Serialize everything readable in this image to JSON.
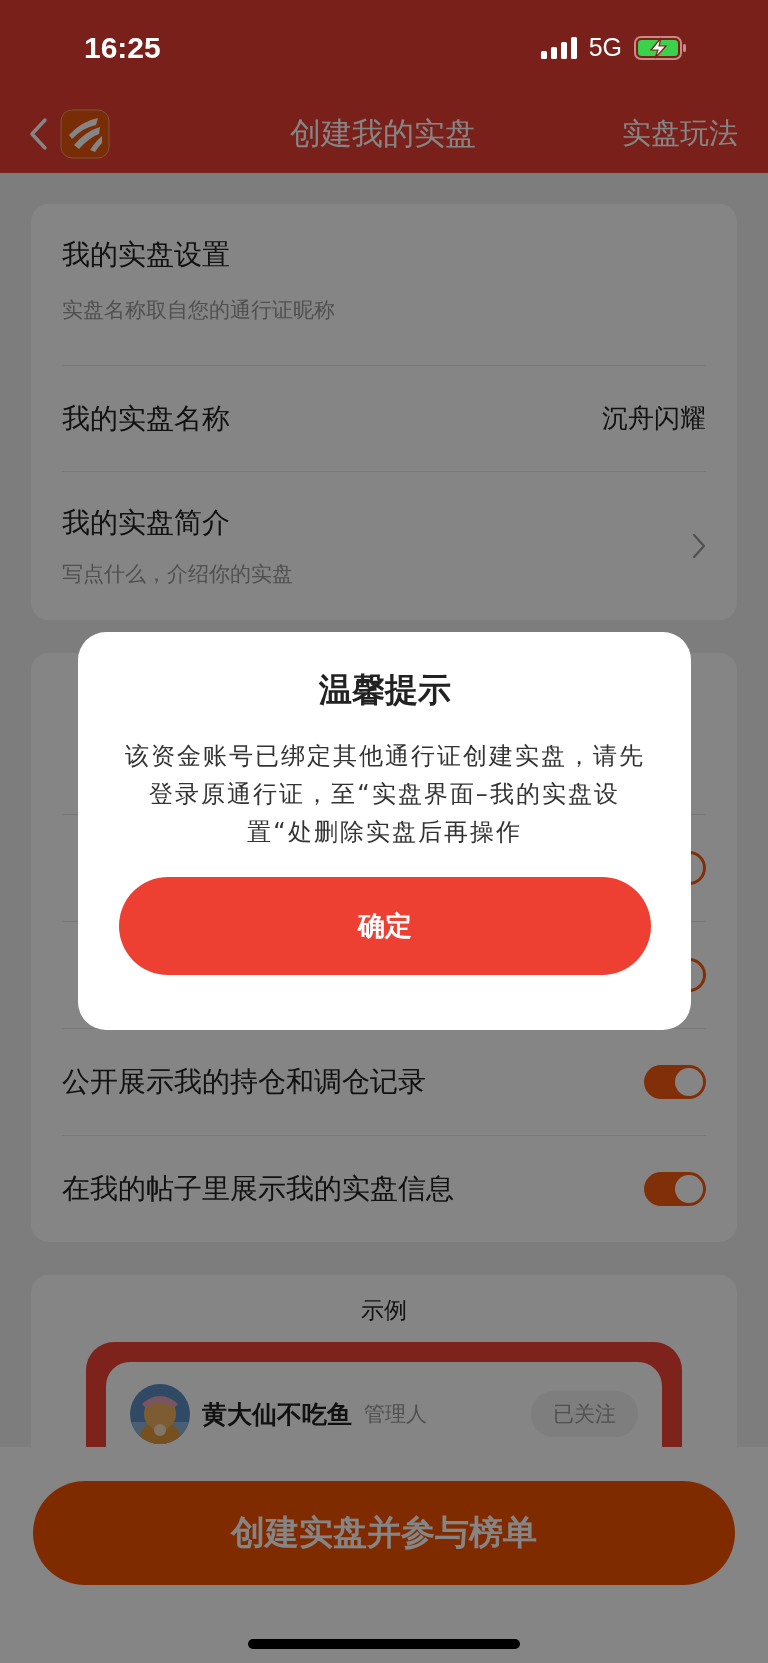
{
  "status_bar": {
    "time": "16:25",
    "network": "5G"
  },
  "nav": {
    "title": "创建我的实盘",
    "action": "实盘玩法"
  },
  "settings_card": {
    "title": "我的实盘设置",
    "subtitle": "实盘名称取自您的通行证昵称",
    "rows": [
      {
        "kind": "value",
        "label": "我的实盘名称",
        "value": "沉舟闪耀"
      },
      {
        "kind": "link",
        "label": "我的实盘简介",
        "subtitle": "写点什么，介绍你的实盘"
      }
    ]
  },
  "privacy_card": {
    "rows": [
      {
        "on": true
      },
      {
        "on": true
      },
      {
        "label": "公开展示我的持仓和调仓记录",
        "on": true
      },
      {
        "label": "在我的帖子里展示我的实盘信息",
        "on": true
      }
    ]
  },
  "example_card": {
    "title": "示例",
    "user": {
      "name": "黄大仙不吃鱼",
      "role": "管理人",
      "follow": "已关注"
    }
  },
  "primary_button": "创建实盘并参与榜单",
  "dialog": {
    "title": "温馨提示",
    "message": "该资金账号已绑定其他通行证创建实盘，请先登录原通行证，至“实盘界面–我的实盘设置“处删除实盘后再操作",
    "button": "确定"
  }
}
